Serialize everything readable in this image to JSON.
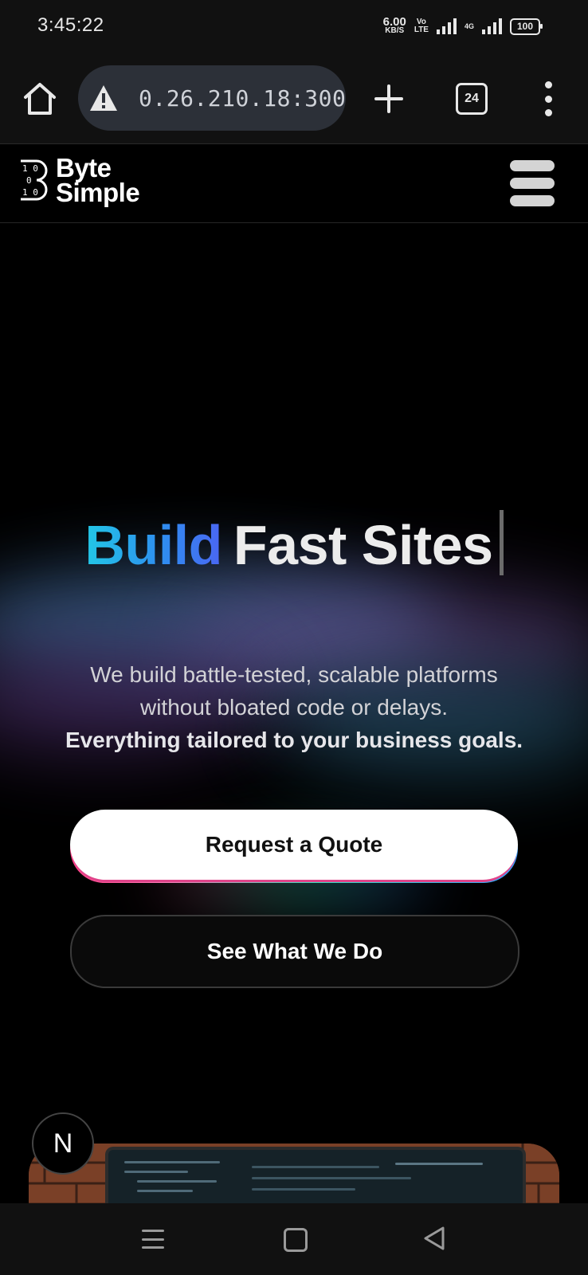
{
  "status_bar": {
    "time": "3:45:22",
    "net_speed_value": "6.00",
    "net_speed_unit": "KB/S",
    "volte_top": "Vo",
    "volte_bottom": "LTE",
    "network_type": "4G",
    "battery": "100"
  },
  "browser": {
    "url": "0.26.210.18:300",
    "tab_count": "24"
  },
  "site": {
    "logo_word1": "Byte",
    "logo_word2": "Simple",
    "logo_digits": "1 0\n0\n1 0"
  },
  "hero": {
    "headline_accent": "Build",
    "headline_rest": "Fast Sites",
    "subcopy_line1": "We build battle-tested, scalable platforms",
    "subcopy_line2": "without bloated code or delays.",
    "subcopy_strong": "Everything tailored to your business goals.",
    "primary_cta": "Request a Quote",
    "secondary_cta": "See What We Do"
  },
  "next_badge": "N",
  "colors": {
    "accent_start": "#22c7e6",
    "accent_end": "#4a66f2",
    "background": "#000000"
  }
}
